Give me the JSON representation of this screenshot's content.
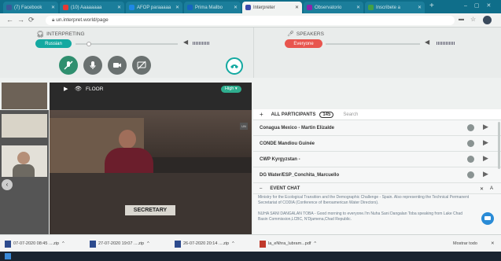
{
  "browser": {
    "tabs": [
      {
        "label": "(7) Facebook",
        "color": "#3b5998"
      },
      {
        "label": "(10) Aaaaaaaa",
        "color": "#e53935"
      },
      {
        "label": "AFOP paraaaaa",
        "color": "#1e88e5"
      },
      {
        "label": "Prima Mailbo",
        "color": "#1565c0"
      },
      {
        "label": "Interpreter",
        "color": "#3949ab"
      },
      {
        "label": "Observatorio",
        "color": "#8e24aa"
      },
      {
        "label": "Inscribete a",
        "color": "#43a047"
      }
    ],
    "new_tab": "+",
    "url": "un.interpret.world/page",
    "back_icon": "back-arrow-icon",
    "forward_icon": "forward-arrow-icon",
    "reload_icon": "reload-icon"
  },
  "controls": {
    "interpreting_label": "INTERPRETING",
    "interpreting_lang": "Russian",
    "speakers_label": "SPEAKERS",
    "speakers_value": "Everyone",
    "accent_teal": "#14a9a1",
    "accent_red": "#e8554e"
  },
  "video": {
    "floor_label": "FLOOR",
    "quality": "High",
    "nameplate": "SECRETARY"
  },
  "participants": {
    "header": "ALL PARTICIPANTS",
    "count": "145",
    "search_placeholder": "Search",
    "rows": [
      "Conagua Mexico - Martin Elizalde",
      "CONDE Mandiou Guinée",
      "CWP Kyrgyzstan -",
      "DG Water/ESP_Conchita_Marcuello"
    ]
  },
  "event_chat": {
    "header": "EVENT CHAT",
    "message_1": "Ministry for the Ecological Transition and the Demographic Challenge - Spain. Also representing the Technical Permanent Secretariat of CODIA (Conference of Iberoamerican Water Directors).",
    "message_2": "NUHA SANI DANGALAN TOBA - Good morning to everyone.I'm Nuha Sani Dangalan Toba speaking from Lake Chad Basin Commission,LCBC, N'Djamena,Chad Republic."
  },
  "downloads": {
    "items": [
      "07-07-2020 08:45 ....zip",
      "27-07-2020 19:07 ....zip",
      "26-07-2020 20:14 ....zip",
      "la_eNhra_lubram...pdf"
    ],
    "show_all": "Mostrar todo"
  }
}
